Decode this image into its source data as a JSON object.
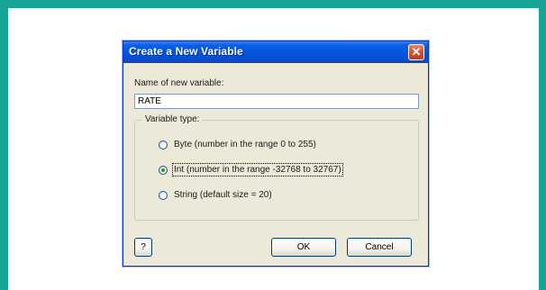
{
  "dialog": {
    "title": "Create a New Variable",
    "close_glyph": "✕",
    "name_label": "Name of new variable:",
    "name_value": "RATE",
    "group_label": "Variable type:",
    "options": [
      {
        "label": "Byte (number in the range 0 to 255)",
        "selected": false
      },
      {
        "label": "Int (number in the range -32768 to 32767)",
        "selected": true
      },
      {
        "label": "String (default size = 20)",
        "selected": false
      }
    ],
    "help_label": "?",
    "ok_label": "OK",
    "cancel_label": "Cancel"
  },
  "colors": {
    "frame": "#17a597",
    "titlebar": "#0753d8",
    "dialog_bg": "#ece9d8",
    "close_button": "#d6502f",
    "radio_selected": "#21a121"
  }
}
